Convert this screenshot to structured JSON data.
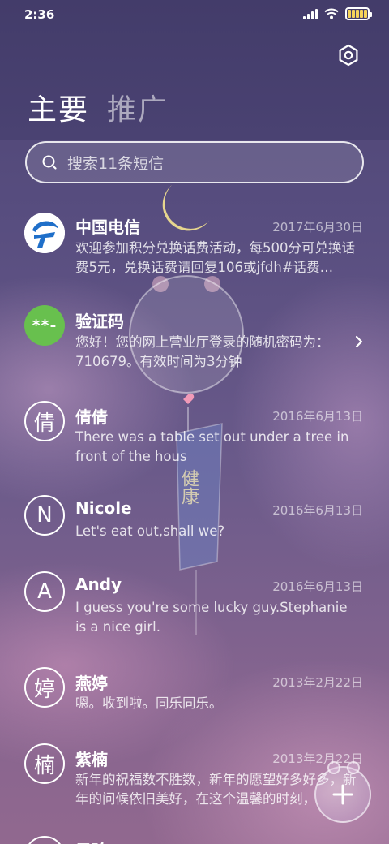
{
  "status_bar": {
    "time": "2:36"
  },
  "header": {
    "tabs": [
      {
        "label": "主要",
        "active": true
      },
      {
        "label": "推广",
        "active": false
      }
    ]
  },
  "search": {
    "placeholder": "搜索11条短信"
  },
  "messages": [
    {
      "sender": "中国电信",
      "date": "2017年6月30日",
      "preview": "欢迎参加积分兑换话费活动，每500分可兑换话费5元，兑换话费请回复106或jfdh#话费…",
      "avatar_type": "logo",
      "avatar_icon": "china-telecom-logo"
    },
    {
      "sender": "验证码",
      "date": "",
      "preview": "您好！您的网上营业厅登录的随机密码为：710679。有效时间为3分钟",
      "avatar_type": "code",
      "avatar_text": "**-",
      "avatar_color": "#68c04e"
    },
    {
      "sender": "倩倩",
      "date": "2016年6月13日",
      "preview": "There was a table set out under a tree in front of the hous",
      "avatar_type": "letter",
      "avatar_text": "倩"
    },
    {
      "sender": "Nicole",
      "date": "2016年6月13日",
      "preview": "Let's eat out,shall we?",
      "avatar_type": "letter",
      "avatar_text": "N"
    },
    {
      "sender": "Andy",
      "date": "2016年6月13日",
      "preview": "I guess you're some lucky guy.Stephanie is a nice girl.",
      "avatar_type": "letter",
      "avatar_text": "A"
    },
    {
      "sender": "燕婷",
      "date": "2013年2月22日",
      "preview": "嗯。收到啦。同乐同乐。",
      "avatar_type": "letter",
      "avatar_text": "婷"
    },
    {
      "sender": "紫楠",
      "date": "2013年2月22日",
      "preview": "新年的祝福数不胜数，新年的愿望好多好多，新年的问候依旧美好，在这个温馨的时刻，",
      "avatar_type": "letter",
      "avatar_text": "楠"
    },
    {
      "sender": "子玲",
      "date": "",
      "preview": "",
      "avatar_type": "letter",
      "avatar_text": "玲"
    }
  ],
  "decoration": {
    "charm_text": "健康"
  },
  "colors": {
    "accent_green": "#68c04e",
    "battery_fill": "#f6d35a",
    "background_top": "#433c6a",
    "background_bottom": "#91688f"
  }
}
